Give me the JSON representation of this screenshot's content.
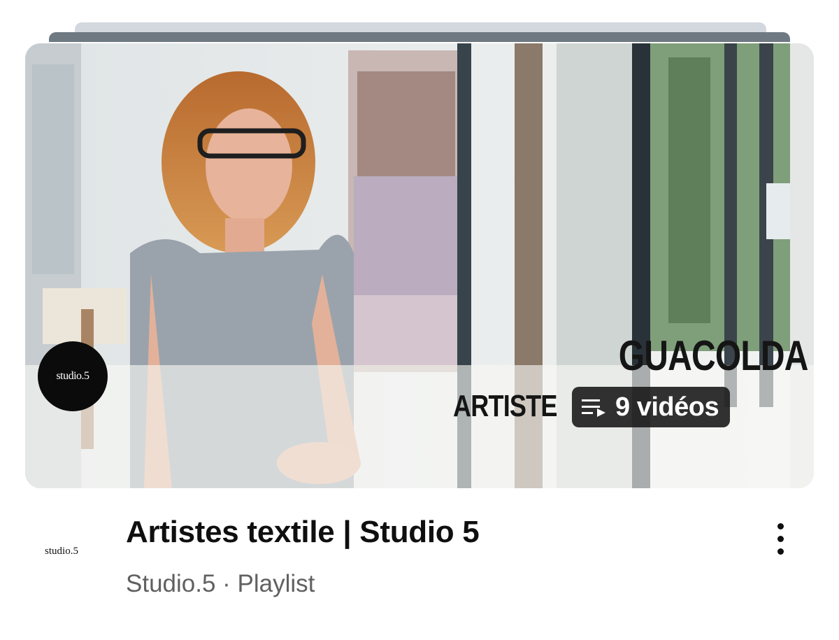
{
  "playlist": {
    "thumbnail": {
      "logo_text": "studio.5",
      "overlay_title": "GUACOLDA",
      "overlay_subtitle": "ARTISTE",
      "video_count": "9 vidéos",
      "count_icon": "playlist-icon"
    },
    "channel_avatar_text": "studio.5",
    "title": "Artistes textile | Studio 5",
    "channel_name": "Studio.5",
    "separator": " · ",
    "type_label": "Playlist",
    "more_icon": "kebab-menu-icon"
  }
}
